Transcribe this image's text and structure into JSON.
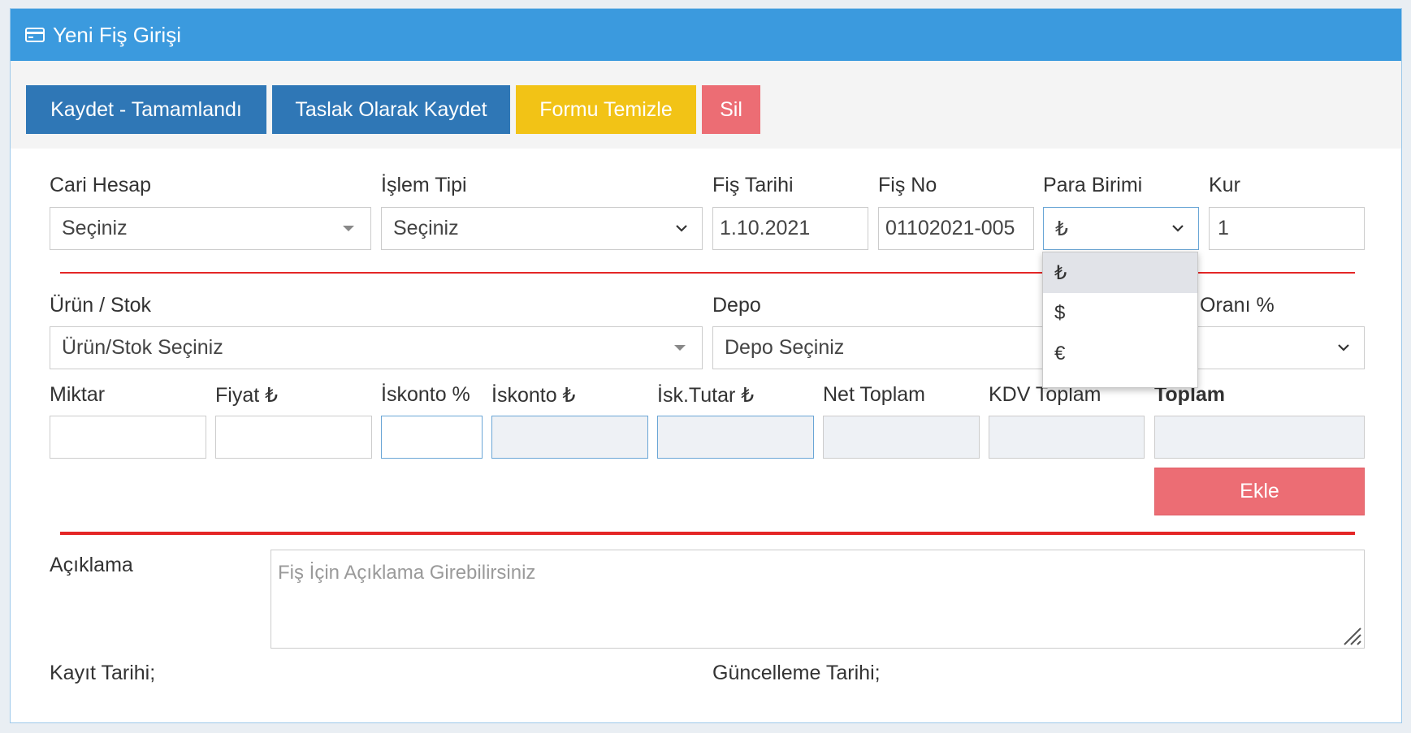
{
  "header": {
    "title": "Yeni Fiş Girişi",
    "icon": "credit-card-icon"
  },
  "toolbar": {
    "save_complete": "Kaydet - Tamamlandı",
    "save_draft": "Taslak Olarak Kaydet",
    "clear_form": "Formu Temizle",
    "delete": "Sil"
  },
  "row1": {
    "cari_hesap": {
      "label": "Cari Hesap",
      "value": "Seçiniz"
    },
    "islem_tipi": {
      "label": "İşlem Tipi",
      "value": "Seçiniz"
    },
    "fis_tarihi": {
      "label": "Fiş Tarihi",
      "value": "1.10.2021"
    },
    "fis_no": {
      "label": "Fiş No",
      "value": "01102021-005"
    },
    "para_birimi": {
      "label": "Para Birimi",
      "value": "₺",
      "options": [
        "₺",
        "$",
        "€"
      ]
    },
    "kur": {
      "label": "Kur",
      "value": "1"
    }
  },
  "row2": {
    "urun_stok": {
      "label": "Ürün / Stok",
      "placeholder": "Ürün/Stok Seçiniz"
    },
    "depo": {
      "label": "Depo",
      "placeholder": "Depo Seçiniz"
    },
    "kdv_orani": {
      "label": "Oranı %"
    }
  },
  "row3": {
    "miktar": "Miktar",
    "fiyat": "Fiyat ₺",
    "iskonto_yuzde": "İskonto %",
    "iskonto_tl": "İskonto ₺",
    "isk_tutar": "İsk.Tutar ₺",
    "net_toplam": "Net Toplam",
    "kdv_toplam": "KDV Toplam",
    "toplam": "Toplam"
  },
  "add_button": "Ekle",
  "aciklama": {
    "label": "Açıklama",
    "placeholder": "Fiş İçin Açıklama Girebilirsiniz"
  },
  "footer": {
    "kayit_tarihi": "Kayıt Tarihi;",
    "guncelleme_tarihi": "Güncelleme Tarihi;"
  },
  "colors": {
    "header": "#3b9ade",
    "primary": "#2f77b6",
    "warning": "#f2c316",
    "danger": "#ec6d74",
    "rule": "#e42626"
  }
}
